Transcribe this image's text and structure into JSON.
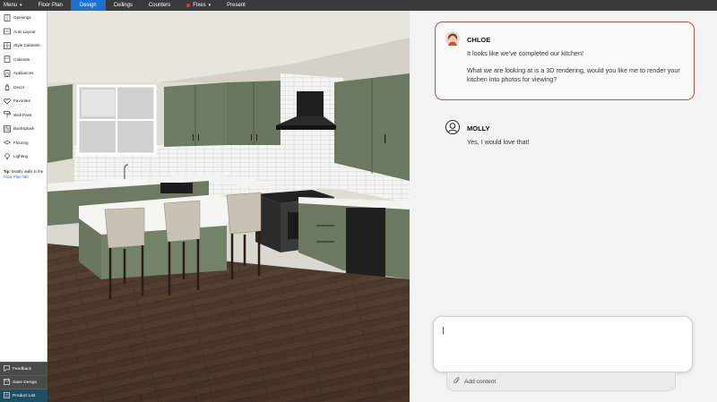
{
  "topbar": {
    "menu_label": "Menu",
    "tabs": [
      {
        "label": "Floor Plan"
      },
      {
        "label": "Design"
      },
      {
        "label": "Ceilings"
      },
      {
        "label": "Counters"
      },
      {
        "label": "Fixes"
      },
      {
        "label": "Present"
      }
    ],
    "active_tab": "Design",
    "active_color": "#1f6fd1"
  },
  "sidebar": {
    "items": [
      {
        "label": "Openings",
        "icon": "openings-icon"
      },
      {
        "label": "Auto Layout",
        "icon": "auto-layout-icon"
      },
      {
        "label": "Style Cabinets",
        "icon": "style-cabinets-icon"
      },
      {
        "label": "Cabinets",
        "icon": "cabinets-icon"
      },
      {
        "label": "Appliances",
        "icon": "appliances-icon"
      },
      {
        "label": "Decor",
        "icon": "decor-icon"
      },
      {
        "label": "Favorites",
        "icon": "heart-icon"
      },
      {
        "label": "Wall Paint",
        "icon": "paint-roller-icon"
      },
      {
        "label": "Backsplash",
        "icon": "backsplash-icon"
      },
      {
        "label": "Flooring",
        "icon": "flooring-icon"
      },
      {
        "label": "Lighting",
        "icon": "lightbulb-icon"
      }
    ],
    "tip": {
      "prefix": "Tip:",
      "text": " Modify walls in the ",
      "link": "Floor Plan Tab"
    },
    "bottom": {
      "feedback": "Feedback",
      "save": "Save Design",
      "product_list": "Product List"
    }
  },
  "chat": {
    "messages": [
      {
        "name": "CHLOE",
        "lines": [
          "It looks like we've completed our kitchen!",
          "What we are looking at is a 3D rendering, would you like me to render your kitchen into photos for viewing?"
        ],
        "highlight_color": "#c0504d"
      },
      {
        "name": "MOLLY",
        "lines": [
          "Yes, I would love that!"
        ]
      }
    ],
    "compose": {
      "placeholder": "",
      "value": ""
    },
    "attach_label": "Add content"
  }
}
